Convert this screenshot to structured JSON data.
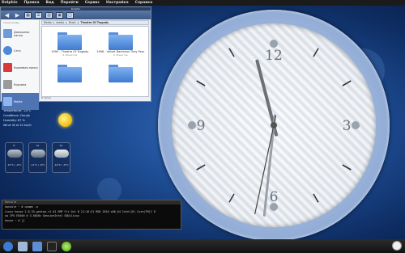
{
  "menubar": {
    "items": [
      "Dolphin",
      "Правка",
      "Вид",
      "Перейти",
      "Сервис",
      "Настройка",
      "Справка"
    ]
  },
  "dolphin": {
    "window_title": "Dolphin",
    "places_header": "Точки входа",
    "places": [
      {
        "label": "Домашняя папка",
        "icon": "home-folder-icon",
        "color": "#6d9ad8"
      },
      {
        "label": "Сеть",
        "icon": "network-icon",
        "color": "#4c8ad8"
      },
      {
        "label": "Корневая папка",
        "icon": "root-folder-icon",
        "color": "#d83a3a"
      },
      {
        "label": "Корзина",
        "icon": "trash-icon",
        "color": "#9a9a9a"
      },
      {
        "label": "Media",
        "icon": "media-folder-icon",
        "color": "#5b8de0",
        "selected": true
      }
    ],
    "breadcrumb": [
      "Media",
      "media",
      "Music",
      "Theatre Of Tragedy"
    ],
    "files": [
      {
        "name": "1995 - Theatre Of Tragedy",
        "sub": "9 объектов"
      },
      {
        "name": "1996 - Velvet Darkness They Fear",
        "sub": "9 объектов"
      },
      {
        "name": "",
        "sub": ""
      },
      {
        "name": "",
        "sub": ""
      }
    ],
    "status": "8 папок"
  },
  "weather": {
    "lines": [
      "Location: Saint-Petersb",
      "Temperature: -15°C",
      "Conditions: Cloudy",
      "Humidity: 87 %",
      "Wind: W at 10 km/h"
    ],
    "forecast": [
      {
        "day": "Fr",
        "temp": "-10°C / -6°C",
        "icon": "rain-cloud-icon"
      },
      {
        "day": "Sa",
        "temp": "-11°C / -8°C",
        "icon": "rain-cloud-icon"
      },
      {
        "day": "Su",
        "temp": "-14°C / -6°C",
        "icon": "cloud-icon"
      }
    ]
  },
  "terminal": {
    "title": "Konsole",
    "lines": [
      "konsole ~ # uname -a",
      "Linux house 2.6.35-gentoo-r5 #1 SMP Fri Oct 8 21:16:51 MSD 2010 x86_64 Intel(R) Core(TM)2 D",
      "uo CPU E8400 @ 3.00GHz GenuineIntel GNU/Linux",
      "house ~ # []"
    ]
  },
  "clock": {
    "numerals": {
      "top": "12",
      "right": "3",
      "bottom": "6",
      "left": "9"
    },
    "hour": 11,
    "minute": 31,
    "second": 32
  },
  "colors": {
    "accent": "#4f74b3",
    "desktop": "#1f4f97"
  }
}
